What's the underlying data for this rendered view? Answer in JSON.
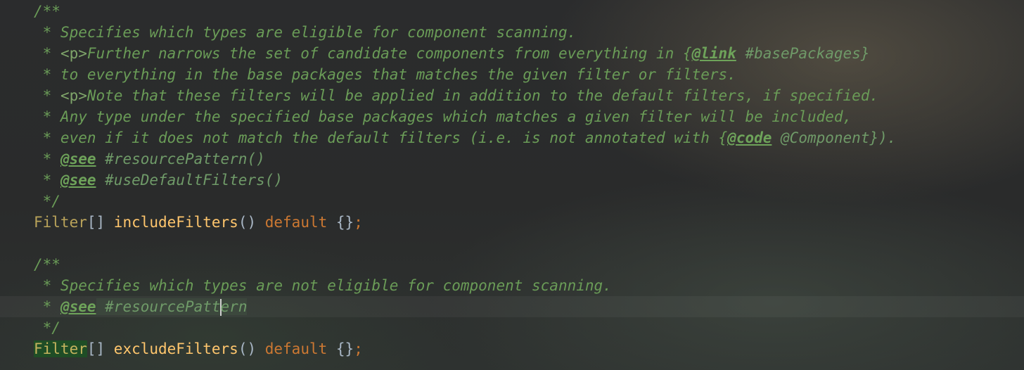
{
  "editor": {
    "block1": {
      "open": "/**",
      "l1": " * Specifies which types are eligible for component scanning.",
      "l2_pre": " * ",
      "l2_tag": "<p>",
      "l2_text": "Further narrows the set of candidate components from everything in {",
      "l2_link": "@link",
      "l2_ref": " #basePackages}",
      "l3": " * to everything in the base packages that matches the given filter or filters.",
      "l4_pre": " * ",
      "l4_tag": "<p>",
      "l4_text": "Note that these filters will be applied in addition to the default filters, if specified.",
      "l5": " * Any type under the specified base packages which matches a given filter will be included,",
      "l6_text": " * even if it does not match the default filters (i.e. is not annotated with {",
      "l6_code": "@code",
      "l6_ref": " @Component}).",
      "see1_pre": " * ",
      "see1_tag": "@see",
      "see1_ref": " #resourcePattern()",
      "see2_pre": " * ",
      "see2_tag": "@see",
      "see2_ref": " #useDefaultFilters()",
      "close": " */"
    },
    "decl1": {
      "type": "Filter",
      "brackets": "[] ",
      "method": "includeFilters",
      "parens": "() ",
      "keyword": "default",
      "body": " {}",
      "semi": ";"
    },
    "block2": {
      "open": "/**",
      "l1": " * Specifies which types are not eligible for component scanning.",
      "see_pre": " * ",
      "see_tag": "@see",
      "see_ref_a": " #resourcePatt",
      "see_ref_b": "ern",
      "close": " */"
    },
    "decl2": {
      "type": "Filter",
      "brackets": "[] ",
      "method": "excludeFilters",
      "parens": "() ",
      "keyword": "default",
      "body": " {}",
      "semi": ";"
    }
  }
}
